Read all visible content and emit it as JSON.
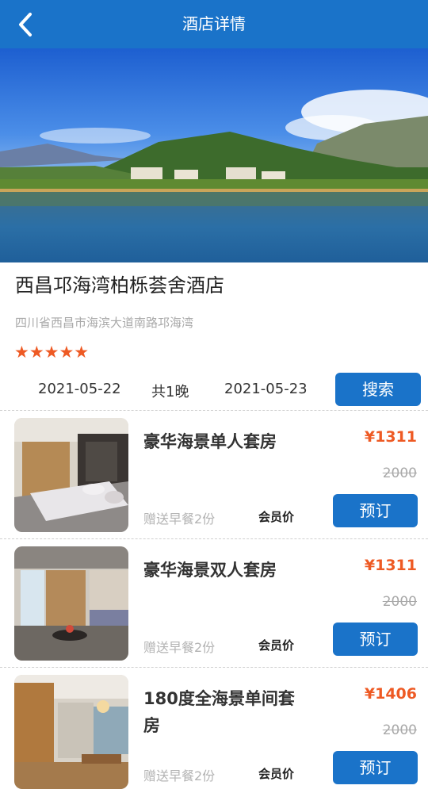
{
  "header": {
    "title": "酒店详情",
    "back_icon": "chevron-left-icon",
    "color": "#1a73c9"
  },
  "hotel": {
    "name": "西昌邛海湾柏栎荟舍酒店",
    "address": "四川省西昌市海滨大道南路邛海湾",
    "stars_text": "★★★★★",
    "rating": 5
  },
  "booking": {
    "check_in": "2021-05-22",
    "nights": "共1晚",
    "check_out": "2021-05-23",
    "search_label": "搜索"
  },
  "rooms": [
    {
      "name": "豪华海景单人套房",
      "price": "¥1311",
      "original_price": "2000",
      "gift": "赠送早餐2份",
      "member_label": "会员价",
      "book_label": "预订"
    },
    {
      "name": "豪华海景双人套房",
      "price": "¥1311",
      "original_price": "2000",
      "gift": "赠送早餐2份",
      "member_label": "会员价",
      "book_label": "预订"
    },
    {
      "name": "180度全海景单间套房",
      "price": "¥1406",
      "original_price": "2000",
      "gift": "赠送早餐2份",
      "member_label": "会员价",
      "book_label": "预订"
    }
  ],
  "colors": {
    "primary": "#1a73c9",
    "price": "#ee5a24",
    "muted": "#a9a9a9"
  }
}
